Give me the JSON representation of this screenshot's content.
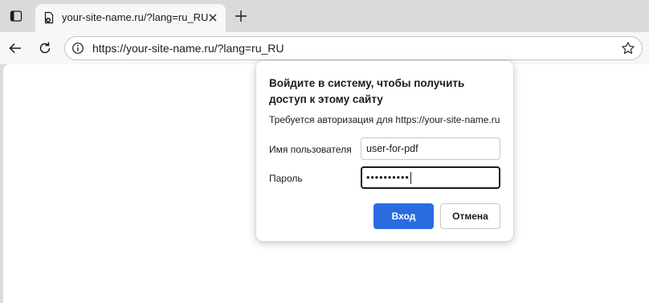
{
  "browser": {
    "tab": {
      "title": "your-site-name.ru/?lang=ru_RU",
      "favicon": "document-blocked-icon"
    },
    "address_bar": {
      "url": "https://your-site-name.ru/?lang=ru_RU"
    },
    "icons": {
      "tab_actions": "tab-actions-icon",
      "close_tab": "close-icon",
      "new_tab": "plus-icon",
      "back": "back-arrow-icon",
      "reload": "reload-icon",
      "site_info": "info-icon",
      "favorite": "star-icon"
    }
  },
  "auth_dialog": {
    "title": "Войдите в систему, чтобы получить доступ к этому сайту",
    "subtitle": "Требуется авторизация для https://your-site-name.ru",
    "username_label": "Имя пользователя",
    "username_value": "user-for-pdf",
    "password_label": "Пароль",
    "password_masked": "••••••••••",
    "login_button": "Вход",
    "cancel_button": "Отмена"
  },
  "colors": {
    "primary_button": "#2a6ce0",
    "titlebar": "#dadada",
    "toolbar": "#f7f7f7"
  }
}
